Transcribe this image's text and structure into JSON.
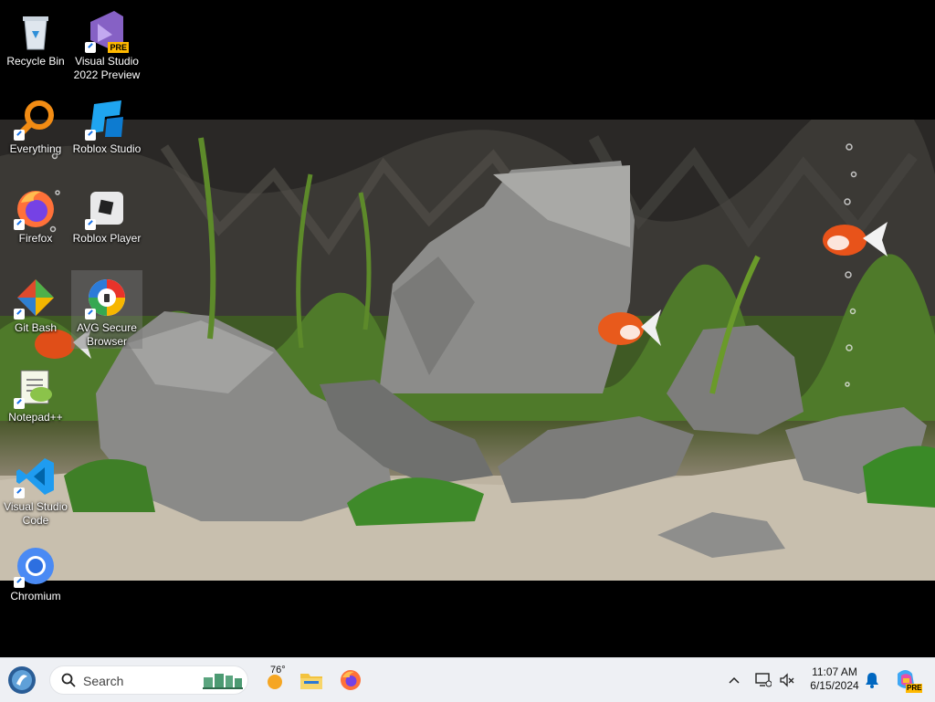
{
  "desktop": {
    "icons": [
      {
        "label": "Recycle Bin",
        "icon": "recycle-bin-icon"
      },
      {
        "label": "Visual Studio 2022 Preview",
        "icon": "visual-studio-preview-icon",
        "badge": "PRE"
      },
      {
        "label": "Everything",
        "icon": "everything-search-icon"
      },
      {
        "label": "Roblox Studio",
        "icon": "roblox-studio-icon"
      },
      {
        "label": "Firefox",
        "icon": "firefox-icon"
      },
      {
        "label": "Roblox Player",
        "icon": "roblox-player-icon"
      },
      {
        "label": "Git Bash",
        "icon": "git-bash-icon"
      },
      {
        "label": "AVG Secure Browser",
        "icon": "avg-secure-browser-icon"
      },
      {
        "label": "Notepad++",
        "icon": "notepad-plus-plus-icon"
      },
      {
        "label": "Visual Studio Code",
        "icon": "vscode-icon"
      },
      {
        "label": "Chromium",
        "icon": "chromium-icon"
      }
    ]
  },
  "taskbar": {
    "search_placeholder": "Search",
    "weather_temp": "76°",
    "apps": [
      "file-explorer-icon",
      "firefox-icon"
    ],
    "time": "11:07 AM",
    "date": "6/15/2024",
    "copilot_badge": "PRE"
  },
  "colors": {
    "taskbar_bg": "#eef0f4",
    "accent": "#0067c0"
  }
}
